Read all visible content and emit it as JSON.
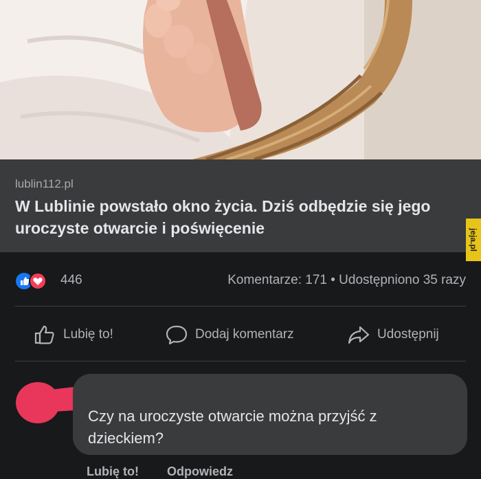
{
  "link": {
    "source": "lublin112.pl",
    "title": "W Lublinie powstało okno życia. Dziś odbędzie się jego uroczyste otwarcie i poświęcenie"
  },
  "watermark": "jeja.pl",
  "stats": {
    "reactions_count": "446",
    "comments_shares": "Komentarze: 171 • Udostępniono 35 razy"
  },
  "actions": {
    "like": "Lubię to!",
    "comment": "Dodaj komentarz",
    "share": "Udostępnij"
  },
  "comment": {
    "text": "Czy na uroczyste otwarcie można przyjść z dzieckiem?",
    "like": "Lubię to!",
    "reply": "Odpowiedz"
  },
  "colors": {
    "background": "#18191a",
    "card": "#3a3b3c",
    "like_blue": "#1877f2",
    "love_red": "#f33e58",
    "scribble": "#e8375a",
    "watermark": "#e8c418"
  }
}
